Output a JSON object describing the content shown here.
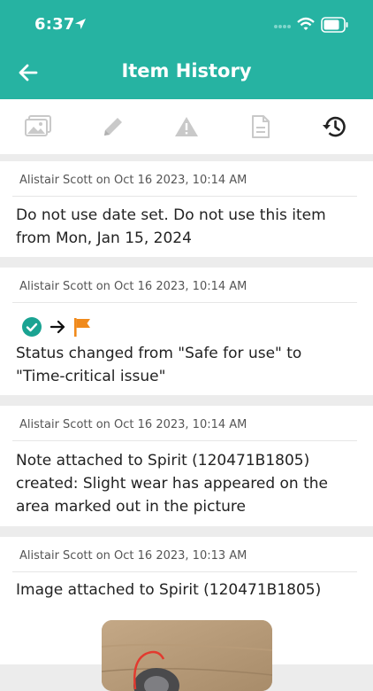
{
  "status_bar": {
    "time": "6:37"
  },
  "header": {
    "title": "Item History"
  },
  "toolbar": {
    "tabs": [
      {
        "icon": "images-icon",
        "active": false
      },
      {
        "icon": "pencil-icon",
        "active": false
      },
      {
        "icon": "warning-icon",
        "active": false
      },
      {
        "icon": "document-icon",
        "active": false
      },
      {
        "icon": "history-icon",
        "active": true
      }
    ]
  },
  "entries": [
    {
      "meta": "Alistair Scott on Oct 16 2023, 10:14 AM",
      "text": "Do not use date set. Do not use this item from Mon, Jan 15, 2024"
    },
    {
      "meta": "Alistair Scott on Oct 16 2023, 10:14 AM",
      "status_from_icon": "check-circle-icon",
      "status_to_icon": "flag-icon",
      "text": "Status changed from \"Safe for use\" to \"Time-critical issue\""
    },
    {
      "meta": "Alistair Scott on Oct 16 2023, 10:14 AM",
      "text": "Note attached to Spirit (120471B1805) created: Slight wear has appeared on the area marked out in the picture"
    },
    {
      "meta": "Alistair Scott on Oct 16 2023, 10:13 AM",
      "text": "Image attached to Spirit (120471B1805)"
    }
  ],
  "colors": {
    "accent": "#26b3a2",
    "check": "#1aa392",
    "flag": "#f08a1c",
    "icon_inactive": "#c9c9c9",
    "icon_active": "#222222"
  }
}
